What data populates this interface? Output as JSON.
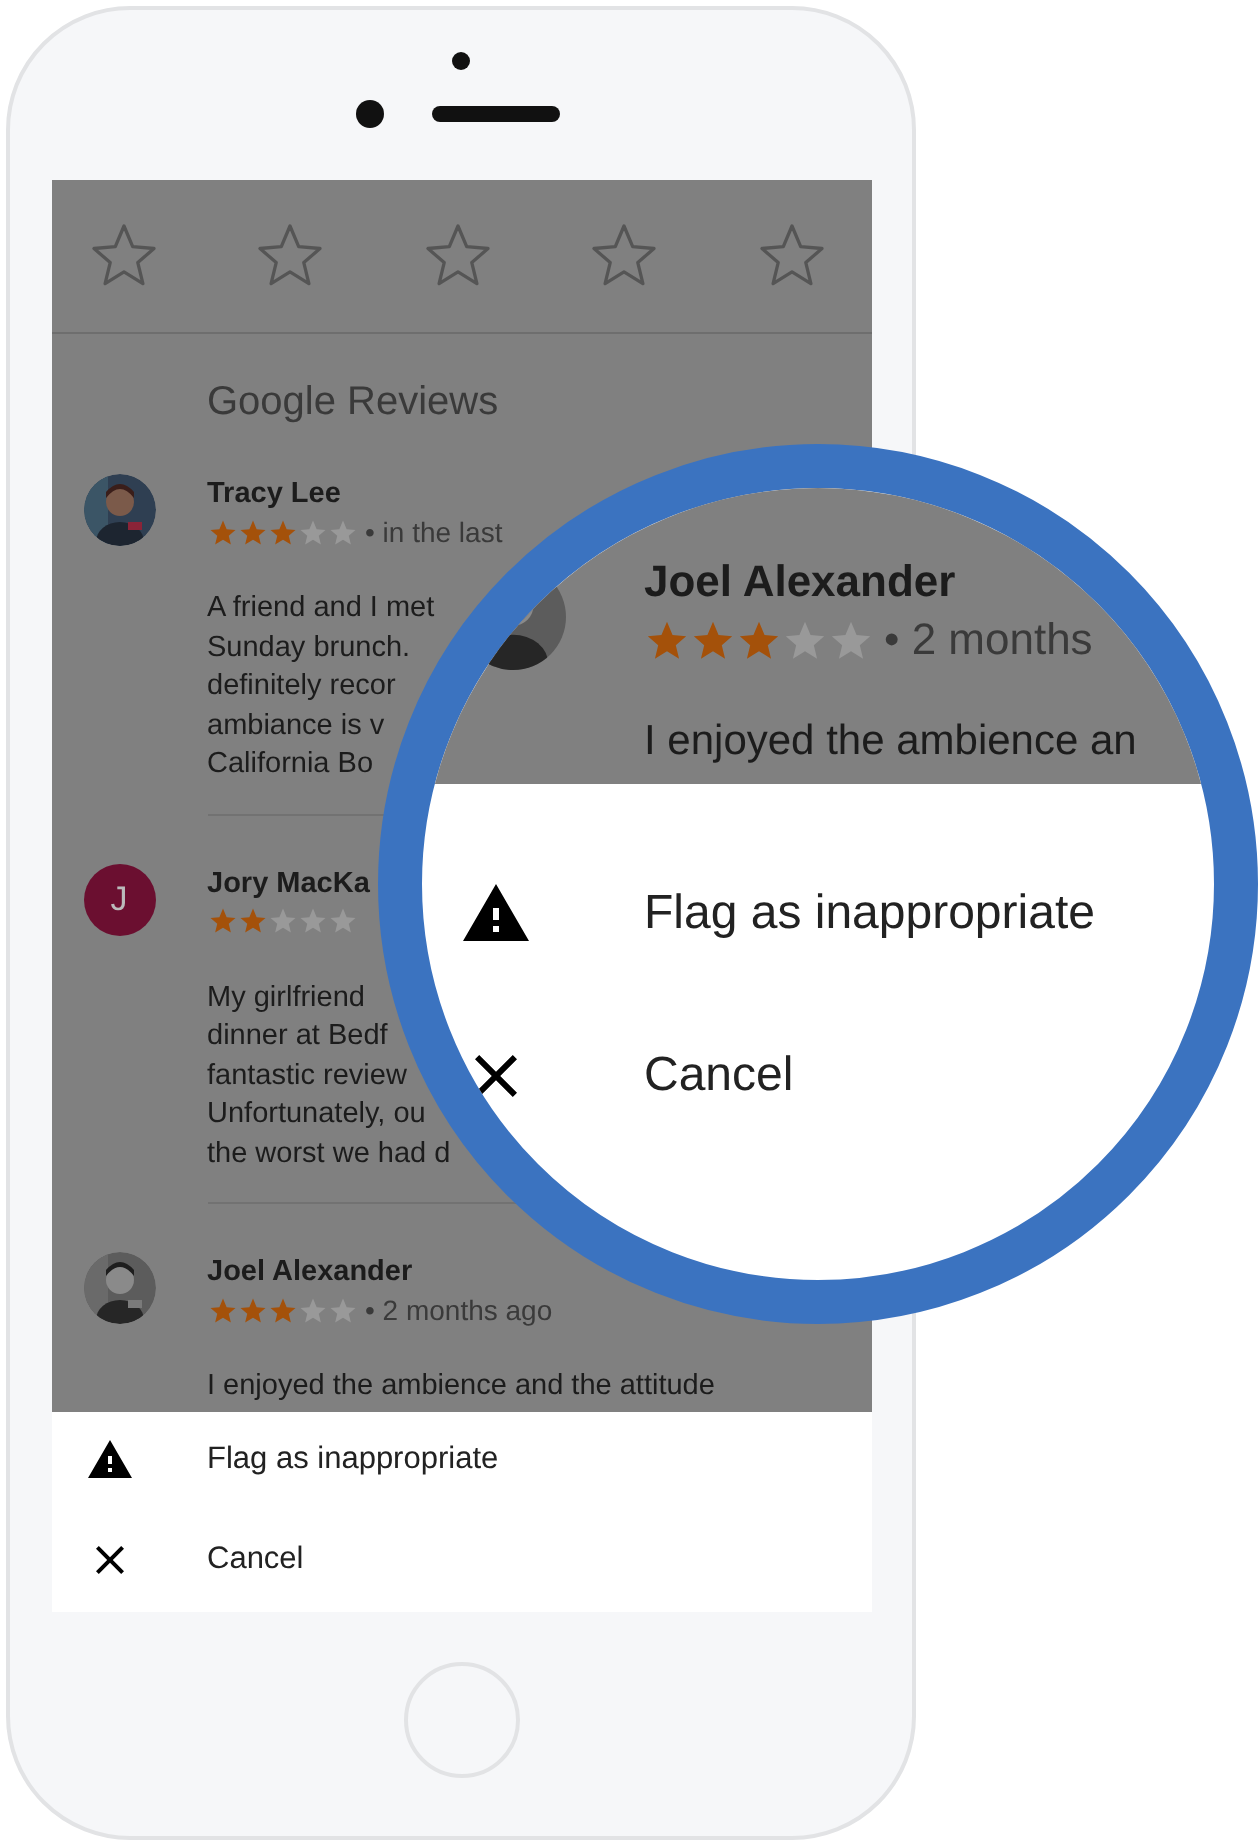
{
  "rating_prompt": {
    "stars": 0
  },
  "section_title": "Google Reviews",
  "reviews": [
    {
      "name": "Tracy Lee",
      "stars": 3,
      "meta": "• in the last",
      "avatar": {
        "kind": "picture"
      },
      "text_lines": [
        "A friend and I met",
        "Sunday brunch.",
        "definitely recor",
        "ambiance is v",
        "California Bo"
      ]
    },
    {
      "name": "Jory MacKa",
      "stars": 2,
      "avatar": {
        "kind": "initial",
        "initial": "J",
        "color": "#6b0f30"
      },
      "text_lines": [
        "My girlfriend",
        "dinner at Bedf",
        "fantastic review",
        "Unfortunately, ou",
        "the worst we had d"
      ]
    },
    {
      "name": "Joel Alexander",
      "stars": 3,
      "meta": "• 2 months ago",
      "avatar": {
        "kind": "picture"
      },
      "text_lines": [
        "I enjoyed the ambience and the attitude"
      ]
    }
  ],
  "sheet": {
    "items": [
      {
        "kind": "warning",
        "label": "Flag as inappropriate"
      },
      {
        "kind": "close",
        "label": "Cancel"
      }
    ]
  },
  "magnifier": {
    "name": "Joel Alexander",
    "stars": 3,
    "meta": "• 2 months",
    "text": "I enjoyed the ambience an",
    "items": [
      {
        "kind": "warning",
        "label": "Flag as inappropriate"
      },
      {
        "kind": "close",
        "label": "Cancel"
      }
    ]
  }
}
